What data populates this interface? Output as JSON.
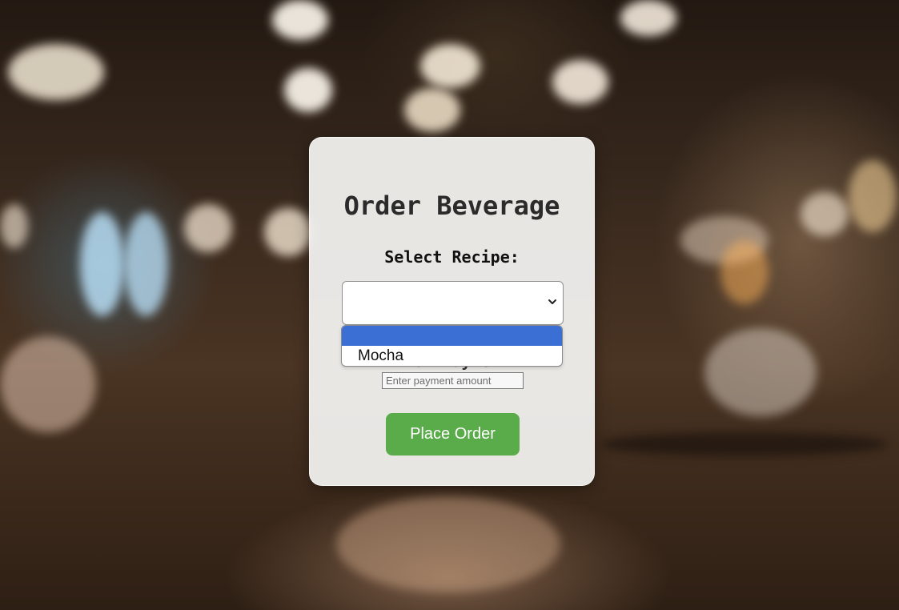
{
  "form": {
    "title": "Order Beverage",
    "recipe_label": "Select Recipe:",
    "recipe_selected": "",
    "payment_label": "Enter Payment:",
    "payment_placeholder": "Enter payment amount",
    "submit_label": "Place Order"
  },
  "recipe_dropdown": {
    "options": [
      "",
      "Mocha"
    ],
    "highlighted_index": 0
  },
  "colors": {
    "submit_button": "#5aac4a",
    "highlight": "#3b6fd3",
    "card": "#f2f2f0"
  }
}
